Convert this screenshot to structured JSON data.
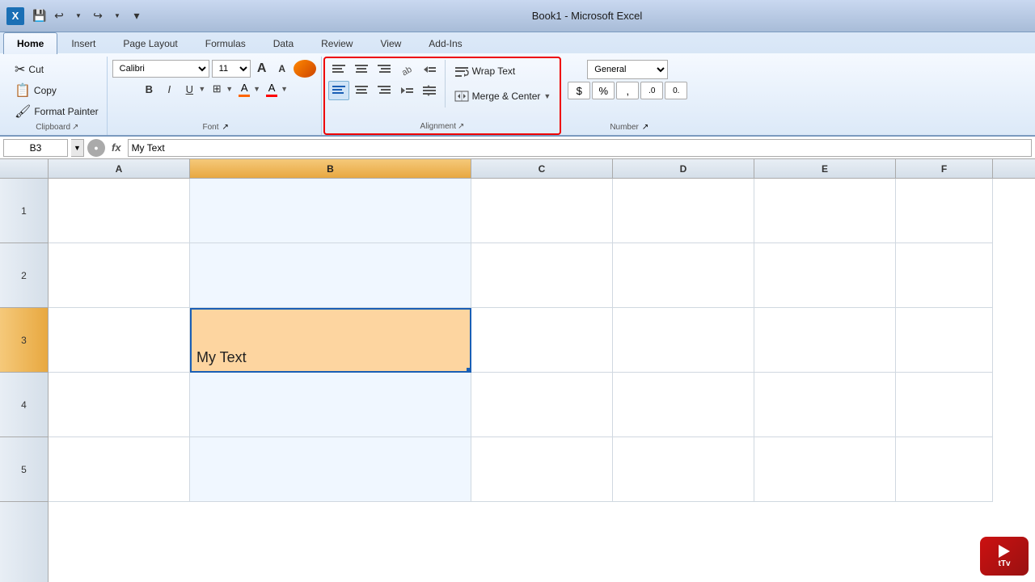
{
  "titleBar": {
    "title": "Book1 - Microsoft Excel",
    "saveIcon": "💾",
    "undoLabel": "↩",
    "redoLabel": "↪"
  },
  "ribbonTabs": [
    {
      "id": "home",
      "label": "Home",
      "active": true
    },
    {
      "id": "insert",
      "label": "Insert",
      "active": false
    },
    {
      "id": "pageLayout",
      "label": "Page Layout",
      "active": false
    },
    {
      "id": "formulas",
      "label": "Formulas",
      "active": false
    },
    {
      "id": "data",
      "label": "Data",
      "active": false
    },
    {
      "id": "review",
      "label": "Review",
      "active": false
    },
    {
      "id": "view",
      "label": "View",
      "active": false
    },
    {
      "id": "addIns",
      "label": "Add-Ins",
      "active": false
    }
  ],
  "clipboard": {
    "groupLabel": "Clipboard",
    "cutLabel": "Cut",
    "copyLabel": "Copy",
    "formatPainterLabel": "Format Painter"
  },
  "font": {
    "groupLabel": "Font",
    "fontName": "Calibri",
    "fontSize": "11",
    "boldLabel": "B",
    "italicLabel": "I",
    "underlineLabel": "U",
    "borderLabel": "⊞",
    "fillColorLabel": "A",
    "fontColorLabel": "A",
    "fillColor": "#ff6600",
    "fontColor": "#ff0000"
  },
  "alignment": {
    "groupLabel": "Alignment",
    "wrapTextLabel": "Wrap Text",
    "mergeCenterLabel": "Merge & Center",
    "topAlignLabel": "≡",
    "middleAlignLabel": "≡",
    "bottomAlignLabel": "≡",
    "leftAlignLabel": "≡",
    "centerAlignLabel": "≡",
    "rightAlignLabel": "≡",
    "indentDecLabel": "⇐",
    "indentIncLabel": "⇒",
    "orientationLabel": "↗"
  },
  "number": {
    "groupLabel": "Number",
    "formatLabel": "General",
    "currencyLabel": "$",
    "percentLabel": "%"
  },
  "formulaBar": {
    "cellRef": "B3",
    "formulaContent": "My Text"
  },
  "columns": [
    {
      "id": "A",
      "label": "A",
      "selected": false
    },
    {
      "id": "B",
      "label": "B",
      "selected": true
    },
    {
      "id": "C",
      "label": "C",
      "selected": false
    },
    {
      "id": "D",
      "label": "D",
      "selected": false
    },
    {
      "id": "E",
      "label": "E",
      "selected": false
    },
    {
      "id": "F",
      "label": "F",
      "selected": false
    }
  ],
  "rows": [
    {
      "id": 1,
      "selected": false
    },
    {
      "id": 2,
      "selected": false
    },
    {
      "id": 3,
      "selected": true
    },
    {
      "id": 4,
      "selected": false
    },
    {
      "id": 5,
      "selected": false
    }
  ],
  "activeCell": {
    "ref": "B3",
    "content": "My Text",
    "row": 3,
    "col": "B"
  }
}
